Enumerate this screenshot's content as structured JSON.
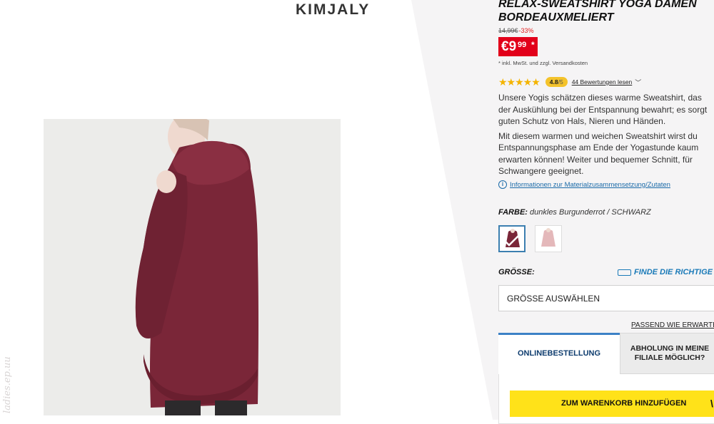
{
  "brand": "KIMJALY",
  "watermark": "ladies.ep.uu",
  "product": {
    "title_line1": "RELAX-SWEATSHIRT YOGA DAMEN",
    "title_line2": "BORDEAUXMELIERT",
    "old_price": "14,99€",
    "discount": "-33%",
    "price_main": "€9",
    "price_cents": "99",
    "price_star": "*",
    "vat_note": "* inkl. MwSt. und zzgl. Versandkosten",
    "rating": {
      "stars": "★★★★★",
      "score": "4.8",
      "denominator": "/5",
      "reviews_label": "44 Bewertungen lesen",
      "value": 4.8
    },
    "description": [
      "Unsere Yogis schätzen dieses warme Sweatshirt, das",
      "der Auskühlung bei der Entspannung bewahrt; es sorgt",
      "guten Schutz von Hals, Nieren und Händen.",
      "Mit diesem warmen und weichen Sweatshirt wirst du",
      "Entspannungsphase am Ende der Yogastunde kaum",
      "erwarten können! Weiter und bequemer Schnitt, für",
      "Schwangere geeignet."
    ],
    "info_link": "Informationen zur Materialzusammensetzung/Zutaten",
    "color_label": "FARBE:",
    "color_value": "dunkles Burgunderrot / SCHWARZ",
    "size_label": "GRÖSSE:",
    "size_guide": "FINDE DIE RICHTIGE G",
    "size_select": "GRÖSSE AUSWÄHLEN",
    "fit_link": "PASSEND WIE ERWARTET (",
    "tab_online": "ONLINEBESTELLUNG",
    "tab_pickup_line1": "ABHOLUNG IN MEINE",
    "tab_pickup_line2": "FILIALE MÖGLICH?",
    "cart_button": "ZUM WARENKORB HINZUFÜGEN",
    "colors": {
      "price_red": "#e2001a",
      "cart_yellow": "#ffe219",
      "accent_blue": "#1a7ab8",
      "sweater": "#7a2638"
    }
  }
}
